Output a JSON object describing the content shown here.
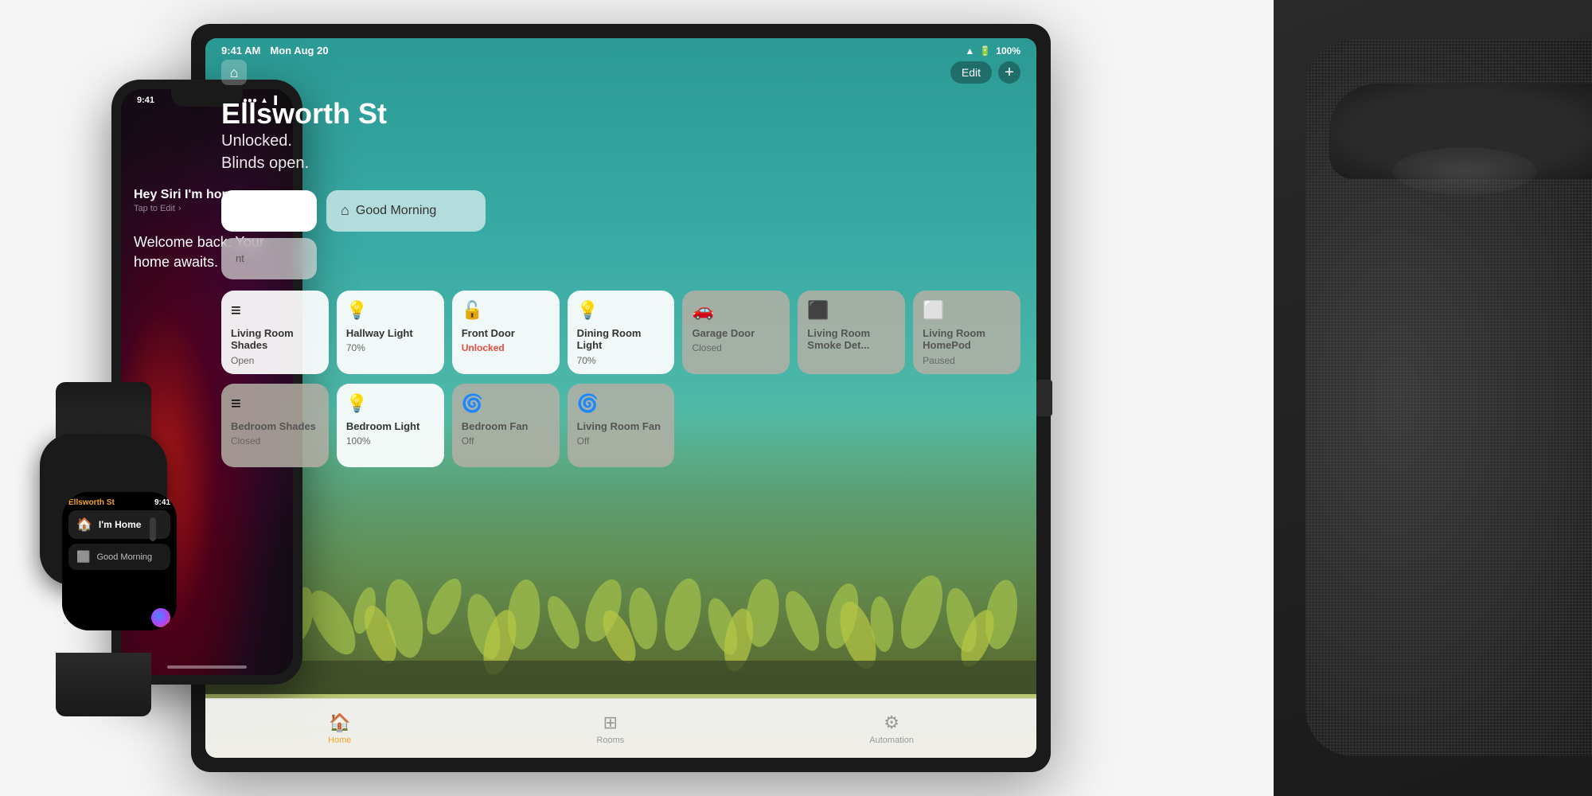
{
  "scene": {
    "bg_color": "#f0f0f0"
  },
  "ipad": {
    "status_bar": {
      "time": "9:41 AM",
      "date": "Mon Aug 20",
      "battery": "100%",
      "signal": "WiFi"
    },
    "location": "Ellsworth St",
    "subtitle_line1": "Unlocked.",
    "subtitle_line2": "Blinds open.",
    "edit_btn": "Edit",
    "add_btn": "+",
    "scenes": {
      "morning_label": "Good Morning"
    },
    "tiles_row1": [
      {
        "icon": "≡",
        "name": "Living Room Shades",
        "status": "Open",
        "dark": false
      },
      {
        "icon": "💡",
        "name": "Hallway Light",
        "status": "70%",
        "dark": false
      },
      {
        "icon": "🔓",
        "name": "Front Door",
        "status": "Unlocked",
        "status_alert": true,
        "dark": false
      },
      {
        "icon": "💡",
        "name": "Dining Room Light",
        "status": "70%",
        "dark": false
      },
      {
        "icon": "🚗",
        "name": "Garage Door",
        "status": "Closed",
        "dark": true
      },
      {
        "icon": "🔲",
        "name": "Living Room Smoke Det...",
        "status": "",
        "dark": true
      },
      {
        "icon": "⬜",
        "name": "Living Room HomePod",
        "status": "Paused",
        "dark": true
      }
    ],
    "tiles_row2": [
      {
        "icon": "≡",
        "name": "Bedroom Shades",
        "status": "Closed",
        "dark": true
      },
      {
        "icon": "💡",
        "name": "Bedroom Light",
        "status": "100%",
        "dark": false,
        "bold_name": true
      },
      {
        "icon": "🌀",
        "name": "Bedroom Fan",
        "status": "Off",
        "dark": true
      },
      {
        "icon": "🌀",
        "name": "Living Room Fan",
        "status": "Off",
        "dark": true
      }
    ],
    "tabbar": {
      "tabs": [
        {
          "icon": "🏠",
          "label": "Home",
          "active": true
        },
        {
          "icon": "⊞",
          "label": "Rooms",
          "active": false
        },
        {
          "icon": "⚙",
          "label": "Automation",
          "active": false
        }
      ]
    }
  },
  "iphone": {
    "status_time": "9:41",
    "status_signal": "●●●",
    "status_wifi": "WiFi",
    "status_battery": "🔋",
    "siri_command": "Hey Siri I'm home",
    "tap_to_edit": "Tap to Edit",
    "response": "Welcome back. Your home awaits."
  },
  "watch": {
    "app_name": "Ellsworth St",
    "time": "9:41",
    "card1": {
      "icon": "🏠",
      "label": "I'm Home"
    },
    "card2": {
      "icon": "⬜",
      "label": "Good Morning"
    }
  }
}
